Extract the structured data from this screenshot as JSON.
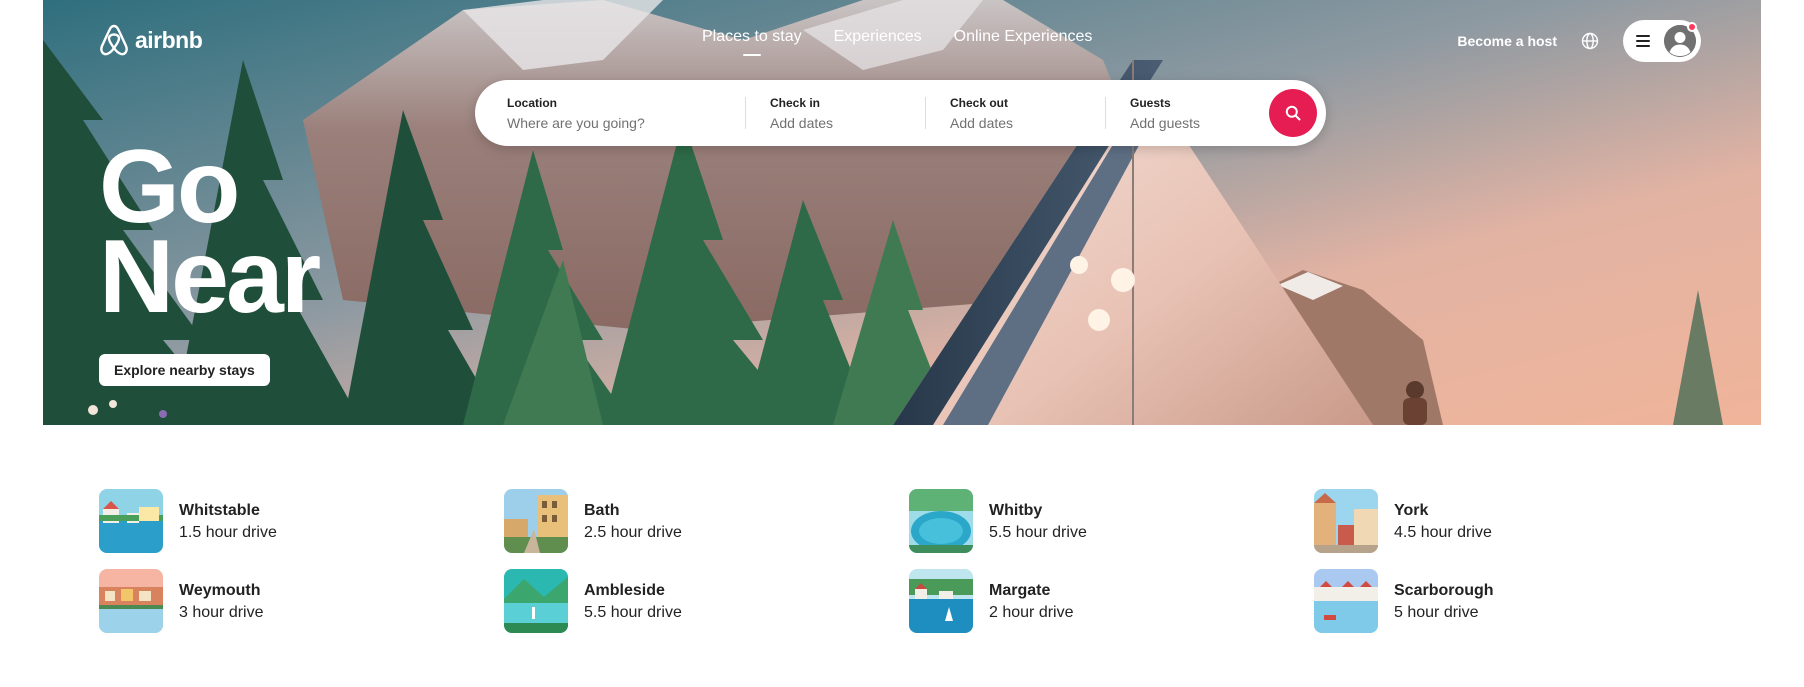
{
  "brand": {
    "name": "airbnb"
  },
  "nav": {
    "tabs": [
      {
        "label": "Places to stay",
        "active": true
      },
      {
        "label": "Experiences",
        "active": false
      },
      {
        "label": "Online Experiences",
        "active": false
      }
    ],
    "become_host": "Become a host",
    "icons": {
      "globe": "globe-icon",
      "menu": "hamburger-icon",
      "avatar": "user-avatar-icon"
    }
  },
  "search": {
    "location": {
      "label": "Location",
      "placeholder": "Where are you going?"
    },
    "check_in": {
      "label": "Check in",
      "value": "Add dates"
    },
    "check_out": {
      "label": "Check out",
      "value": "Add dates"
    },
    "guests": {
      "label": "Guests",
      "value": "Add guests"
    },
    "button_icon": "search-icon"
  },
  "hero": {
    "headline_line1": "Go",
    "headline_line2": "Near",
    "cta": "Explore nearby stays"
  },
  "nearby": [
    {
      "name": "Whitstable",
      "drive": "1.5 hour drive"
    },
    {
      "name": "Bath",
      "drive": "2.5 hour drive"
    },
    {
      "name": "Whitby",
      "drive": "5.5 hour drive"
    },
    {
      "name": "York",
      "drive": "4.5 hour drive"
    },
    {
      "name": "Weymouth",
      "drive": "3 hour drive"
    },
    {
      "name": "Ambleside",
      "drive": "5.5 hour drive"
    },
    {
      "name": "Margate",
      "drive": "2 hour drive"
    },
    {
      "name": "Scarborough",
      "drive": "5 hour drive"
    }
  ],
  "colors": {
    "brand_accent": "#e51d53",
    "text_primary": "#222222",
    "text_secondary": "#717171",
    "notification": "#ff385c"
  }
}
